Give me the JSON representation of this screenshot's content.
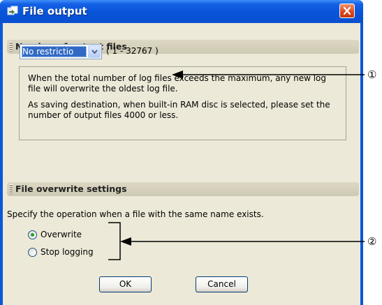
{
  "window": {
    "title": "File output",
    "close_icon": "close-icon"
  },
  "sections": {
    "output_files": {
      "title": "Number of output files",
      "combo_value": "No restrictio",
      "range": "( 1 - 32767 )",
      "info_paragraphs": [
        "When the total number of log files exceeds the maximum, any new log file will overwrite the oldest log file.",
        "As saving destination, when built-in RAM disc is selected, please set the number of output files 4000 or less."
      ]
    },
    "overwrite": {
      "title": "File overwrite settings",
      "description": "Specify the operation when a file with the same name exists.",
      "options": [
        {
          "label": "Overwrite",
          "checked": true
        },
        {
          "label": "Stop logging",
          "checked": false
        }
      ]
    }
  },
  "buttons": {
    "ok": "OK",
    "cancel": "Cancel"
  },
  "annotations": {
    "first": "①",
    "second": "②"
  },
  "colors": {
    "titlebar": "#0a58d6",
    "client": "#ece9d8",
    "close": "#d8451a",
    "selection": "#316ac5"
  }
}
